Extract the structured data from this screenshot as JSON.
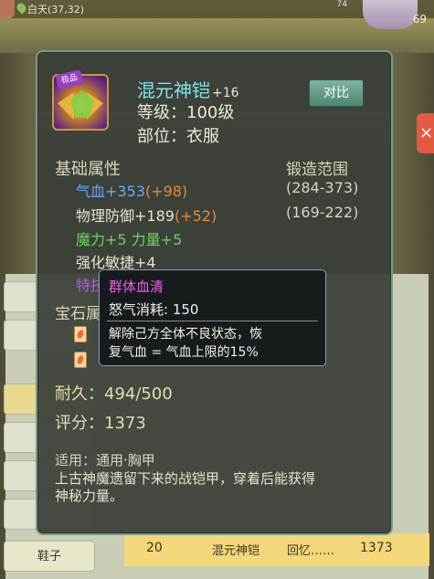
{
  "status_bar": {
    "location": "白天(37,32)",
    "level": "69",
    "small_level": "74"
  },
  "item": {
    "badge": "极品",
    "name": "混元神铠",
    "plus": "+16",
    "level_line": "等级：100级",
    "slot_line": "部位：衣服",
    "compare_button": "对比"
  },
  "attributes": {
    "header": "基础属性",
    "range_header": "锻造范围",
    "hp_label": "气血",
    "hp_value": "+353",
    "hp_bonus": "(+98)",
    "hp_range": "(284-373)",
    "def_label": "物理防御",
    "def_value": "+189",
    "def_bonus": "(+52)",
    "def_range": "(169-222)",
    "magic_line": "魔力+5 力量+5",
    "agility_line": "强化敏捷+4",
    "special_label": "特技",
    "gem_label": "宝石属"
  },
  "durability": "耐久：494/500",
  "score": "评分：1373",
  "usage": "适用：通用·胸甲",
  "description_1": "上古神魔遗留下来的战铠甲，穿着后能获得",
  "description_2": "神秘力量。",
  "skill_tip": {
    "name": "群体血清",
    "cost": "怒气消耗: 150",
    "desc_1": "解除己方全体不良状态，恢",
    "desc_2": "复气血 = 气血上限的15%"
  },
  "background": {
    "shoes_tab": "鞋子",
    "last_row_num": "20",
    "last_row_name": "混元神铠",
    "last_row_owner": "回忆……",
    "last_row_score": "1373"
  }
}
